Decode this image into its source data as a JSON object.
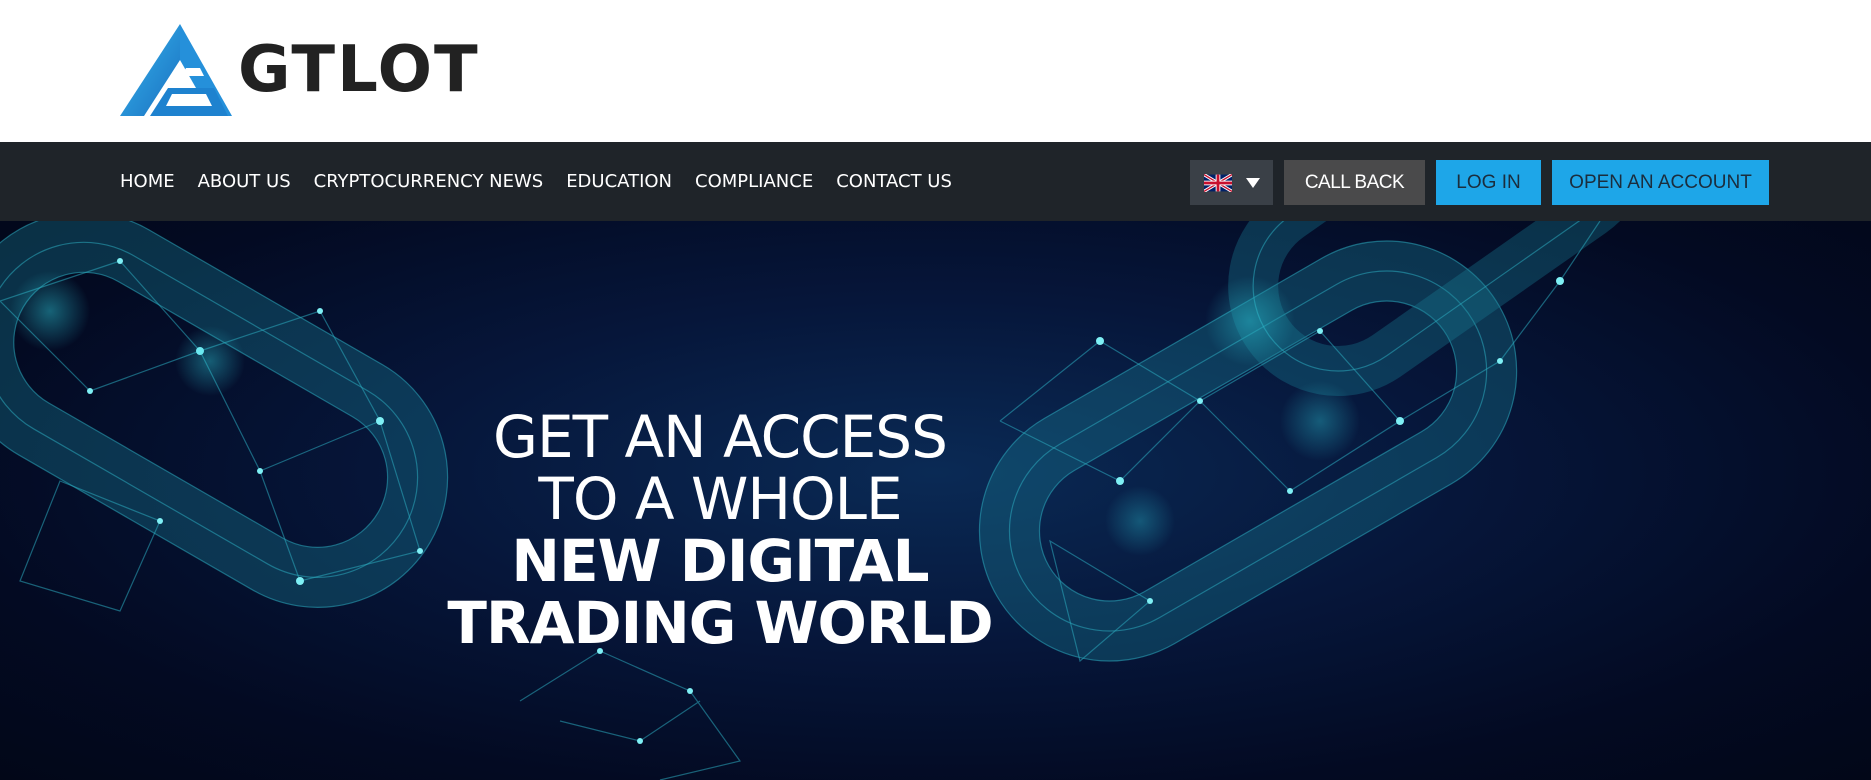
{
  "brand": {
    "name": "GTLOT",
    "logo_icon": "gtlot-logo-icon"
  },
  "nav": {
    "links": [
      "HOME",
      "ABOUT US",
      "CRYPTOCURRENCY NEWS",
      "EDUCATION",
      "COMPLIANCE",
      "CONTACT US"
    ],
    "language": {
      "flag": "uk-flag-icon",
      "dropdown_icon": "caret-down-icon"
    },
    "call_back": "CALL BACK",
    "log_in": "LOG IN",
    "open_account": "OPEN AN ACCOUNT"
  },
  "hero": {
    "lines": [
      "GET AN ACCESS",
      "TO A WHOLE",
      "NEW DIGITAL",
      "TRADING WORLD"
    ]
  },
  "colors": {
    "accent": "#1ea6e8",
    "nav_bg": "#1f2429",
    "hero_bg": "#030a22",
    "network": "#2fb8c8"
  }
}
